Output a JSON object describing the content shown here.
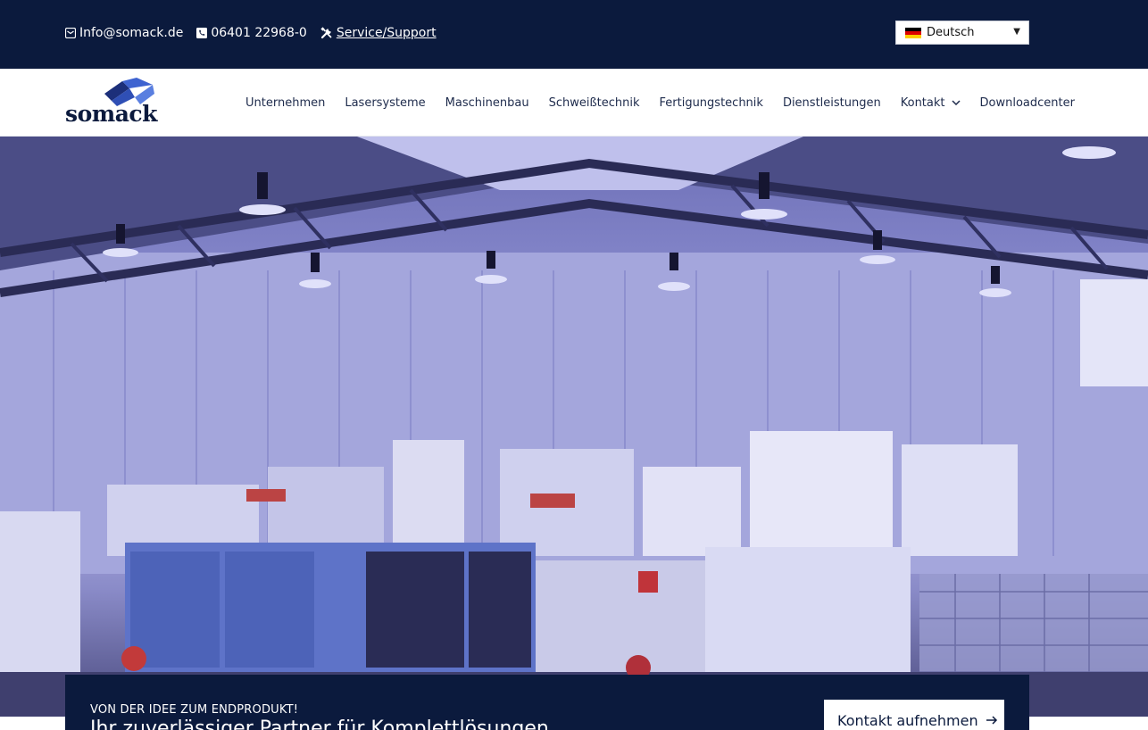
{
  "topbar": {
    "email": "Info@somack.de",
    "phone": "06401 22968-0",
    "support": "Service/Support",
    "language": {
      "selected": "Deutsch",
      "flag": "german-flag-icon"
    }
  },
  "brand": {
    "name": "somack"
  },
  "nav": {
    "items": [
      {
        "label": "Unternehmen"
      },
      {
        "label": "Lasersysteme"
      },
      {
        "label": "Maschinenbau"
      },
      {
        "label": "Schweißtechnik"
      },
      {
        "label": "Fertigungstechnik"
      },
      {
        "label": "Dienstleistungen"
      },
      {
        "label": "Kontakt",
        "has_dropdown": true
      },
      {
        "label": "Downloadcenter"
      }
    ]
  },
  "hero": {
    "image": "workshop-hall-photo"
  },
  "cta": {
    "eyebrow": "VON DER IDEE ZUM ENDPRODUKT!",
    "headline": "Ihr zuverlässiger Partner für Komplettlösungen",
    "button": "Kontakt aufnehmen"
  },
  "colors": {
    "navy": "#0b1a3d",
    "nav_text": "#1e2b4c",
    "logo_blue": "#2f4fb5"
  }
}
